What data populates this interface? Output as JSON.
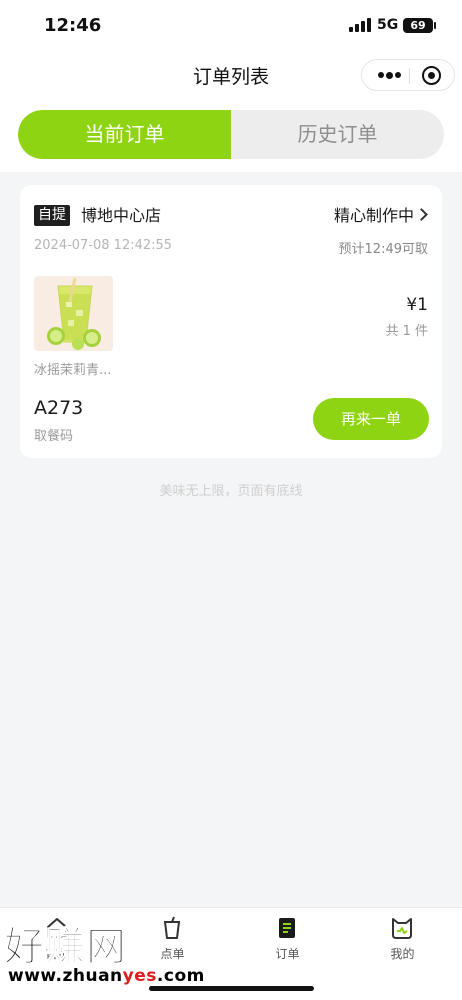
{
  "status_bar": {
    "time": "12:46",
    "network": "5G",
    "battery": "69"
  },
  "nav": {
    "title": "订单列表"
  },
  "tabs": {
    "current": "当前订单",
    "history": "历史订单"
  },
  "order": {
    "pickup_type": "自提",
    "store": "博地中心店",
    "status": "精心制作中",
    "datetime": "2024-07-08 12:42:55",
    "eta": "预计12:49可取",
    "product_name": "冰摇茉莉青...",
    "price": "¥1",
    "count": "共 1 件",
    "pickup_code": "A273",
    "pickup_code_label": "取餐码",
    "reorder_label": "再来一单"
  },
  "footer_text": "美味无上限，页面有底线",
  "tabbar": {
    "items": [
      {
        "label": "首页",
        "icon": "home-icon"
      },
      {
        "label": "点单",
        "icon": "cup-icon"
      },
      {
        "label": "订单",
        "icon": "order-doc-icon"
      },
      {
        "label": "我的",
        "icon": "cat-profile-icon"
      }
    ]
  },
  "watermark": {
    "big": "好赚网",
    "small_pre": "www.zhuan",
    "small_hl": "yes",
    "small_post": ".com"
  },
  "colors": {
    "accent": "#8fd413",
    "background": "#f4f5f7"
  }
}
